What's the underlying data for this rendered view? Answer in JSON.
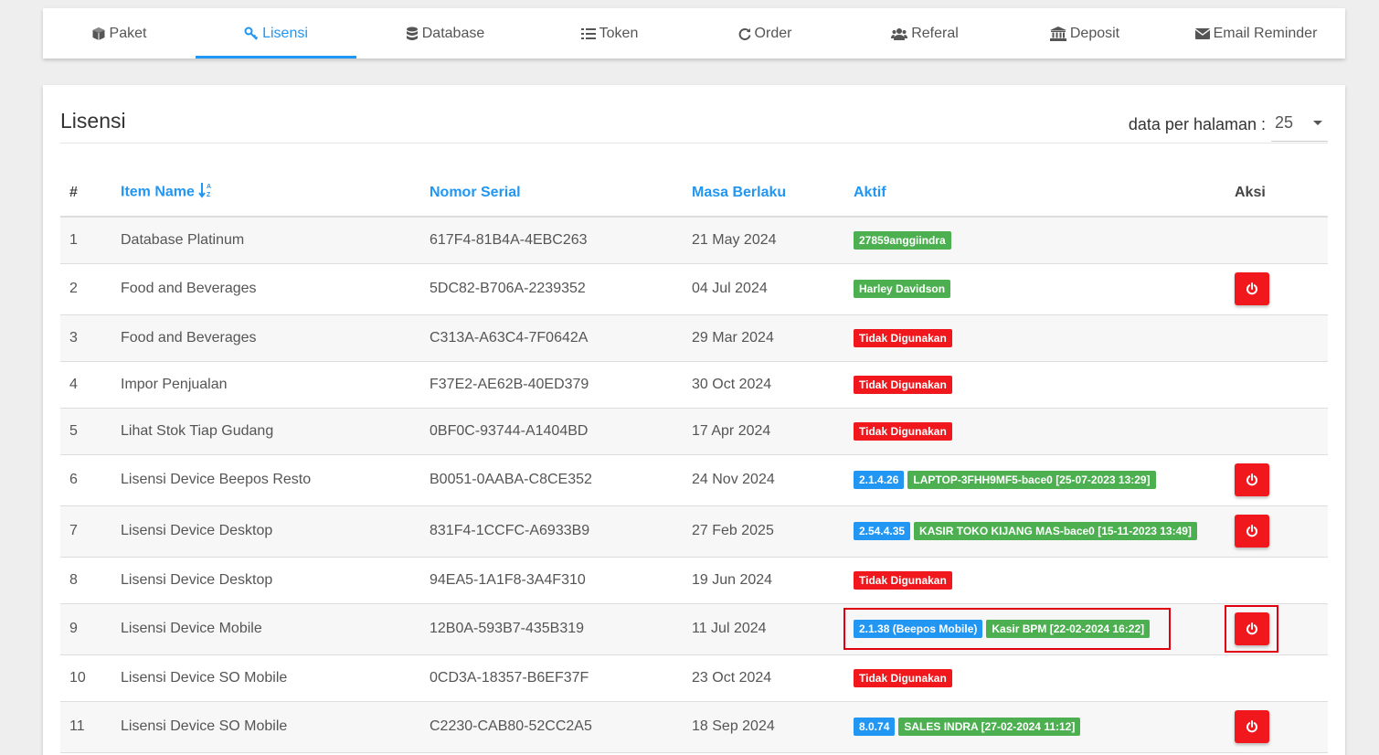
{
  "tabs": [
    {
      "label": "Paket",
      "icon": "cube-icon"
    },
    {
      "label": "Lisensi",
      "icon": "key-icon",
      "active": true
    },
    {
      "label": "Database",
      "icon": "database-icon"
    },
    {
      "label": "Token",
      "icon": "list-icon"
    },
    {
      "label": "Order",
      "icon": "refresh-icon"
    },
    {
      "label": "Referal",
      "icon": "users-icon"
    },
    {
      "label": "Deposit",
      "icon": "bank-icon"
    },
    {
      "label": "Email Reminder",
      "icon": "envelope-icon"
    }
  ],
  "page": {
    "title": "Lisensi",
    "per_page_label": "data per halaman :",
    "per_page_value": "25"
  },
  "table": {
    "headers": {
      "num": "#",
      "item_name": "Item Name",
      "serial": "Nomor Serial",
      "expiry": "Masa Berlaku",
      "active": "Aktif",
      "action": "Aksi"
    },
    "rows": [
      {
        "num": "1",
        "item": "Database Platinum",
        "serial": "617F4-81B4A-4EBC263",
        "expiry": "21 May 2024",
        "badges": [
          {
            "text": "27859anggiindra",
            "color": "green"
          }
        ],
        "power": false
      },
      {
        "num": "2",
        "item": "Food and Beverages",
        "serial": "5DC82-B706A-2239352",
        "expiry": "04 Jul 2024",
        "badges": [
          {
            "text": "Harley Davidson",
            "color": "green"
          }
        ],
        "power": true
      },
      {
        "num": "3",
        "item": "Food and Beverages",
        "serial": "C313A-A63C4-7F0642A",
        "expiry": "29 Mar 2024",
        "badges": [
          {
            "text": "Tidak Digunakan",
            "color": "red"
          }
        ],
        "power": false
      },
      {
        "num": "4",
        "item": "Impor Penjualan",
        "serial": "F37E2-AE62B-40ED379",
        "expiry": "30 Oct 2024",
        "badges": [
          {
            "text": "Tidak Digunakan",
            "color": "red"
          }
        ],
        "power": false
      },
      {
        "num": "5",
        "item": "Lihat Stok Tiap Gudang",
        "serial": "0BF0C-93744-A1404BD",
        "expiry": "17 Apr 2024",
        "badges": [
          {
            "text": "Tidak Digunakan",
            "color": "red"
          }
        ],
        "power": false
      },
      {
        "num": "6",
        "item": "Lisensi Device Beepos Resto",
        "serial": "B0051-0AABA-C8CE352",
        "expiry": "24 Nov 2024",
        "badges": [
          {
            "text": "2.1.4.26",
            "color": "blue"
          },
          {
            "text": "LAPTOP-3FHH9MF5-bace0 [25-07-2023 13:29]",
            "color": "green"
          }
        ],
        "power": true
      },
      {
        "num": "7",
        "item": "Lisensi Device Desktop",
        "serial": "831F4-1CCFC-A6933B9",
        "expiry": "27 Feb 2025",
        "badges": [
          {
            "text": "2.54.4.35",
            "color": "blue"
          },
          {
            "text": "KASIR TOKO KIJANG MAS-bace0 [15-11-2023 13:49]",
            "color": "green"
          }
        ],
        "power": true
      },
      {
        "num": "8",
        "item": "Lisensi Device Desktop",
        "serial": "94EA5-1A1F8-3A4F310",
        "expiry": "19 Jun 2024",
        "badges": [
          {
            "text": "Tidak Digunakan",
            "color": "red"
          }
        ],
        "power": false
      },
      {
        "num": "9",
        "item": "Lisensi Device Mobile",
        "serial": "12B0A-593B7-435B319",
        "expiry": "11 Jul 2024",
        "badges": [
          {
            "text": "2.1.38 (Beepos Mobile)",
            "color": "blue"
          },
          {
            "text": "Kasir BPM [22-02-2024 16:22]",
            "color": "green"
          }
        ],
        "power": true
      },
      {
        "num": "10",
        "item": "Lisensi Device SO Mobile",
        "serial": "0CD3A-18357-B6EF37F",
        "expiry": "23 Oct 2024",
        "badges": [
          {
            "text": "Tidak Digunakan",
            "color": "red"
          }
        ],
        "power": false
      },
      {
        "num": "11",
        "item": "Lisensi Device SO Mobile",
        "serial": "C2230-CAB80-52CC2A5",
        "expiry": "18 Sep 2024",
        "badges": [
          {
            "text": "8.0.74",
            "color": "blue"
          },
          {
            "text": "SALES INDRA [27-02-2024 11:12]",
            "color": "green"
          }
        ],
        "power": true
      }
    ]
  },
  "colors": {
    "accent": "#2196f3",
    "danger": "#f0181d",
    "success": "#4caf50"
  }
}
